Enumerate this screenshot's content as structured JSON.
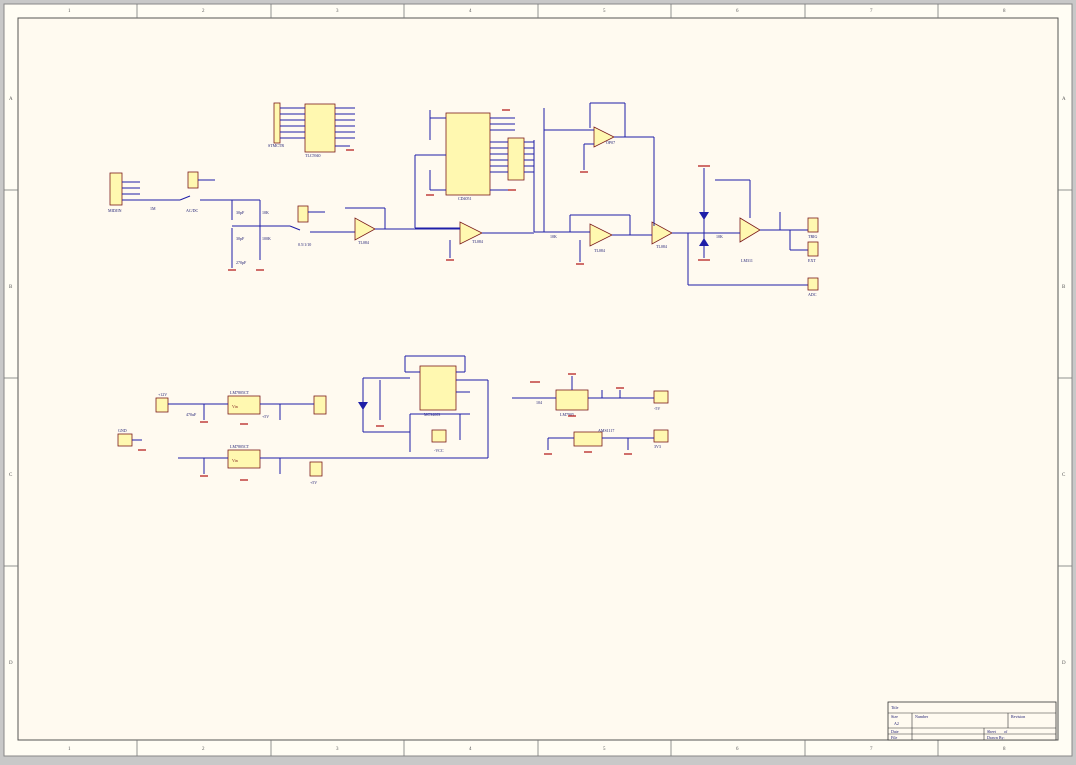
{
  "sheet": {
    "zones_top": [
      "1",
      "2",
      "3",
      "4",
      "5",
      "6",
      "7",
      "8"
    ],
    "zones_side": [
      "A",
      "B",
      "C",
      "D"
    ]
  },
  "title_block": {
    "title": "Title",
    "size_label": "Size",
    "size": "A2",
    "number_label": "Number",
    "revision_label": "Revision",
    "date_label": "Date",
    "file_label": "File",
    "sheet_label": "Sheet",
    "of_label": "of",
    "drawn_label": "Drawn By:"
  },
  "parts": {
    "tc_driver": "TLC5940",
    "cd_mux": "CD4051",
    "stepper": "STMCTR",
    "header_in": "MIDJIN",
    "relay1": "AC/DC",
    "relay2": "0.5/1/10",
    "op1": "TL084",
    "op2": "TL084",
    "op3": "TL084",
    "op4": "TL084",
    "op5": "OP07",
    "comp": "LM311",
    "reg1": "LM7805CT",
    "reg2": "LM7805CT",
    "timer": "MC34063",
    "reg3": "LM7905",
    "reg4": "AMS1117",
    "out1": "TRIG",
    "out2": "EXT",
    "out3": "ADC",
    "pwr1": "+12V",
    "pwr2": "+5V",
    "pwr3": "-5V",
    "pwr4": "3V3"
  },
  "labels": {
    "r1": "1M",
    "r2": "10K",
    "r3": "100K",
    "r4": "10K",
    "r5": "10K",
    "c1": "30pF",
    "c2": "30pF",
    "c3": "270pF",
    "c4": "470uF",
    "c5": "104",
    "gnd": "GND",
    "vin": "Vin",
    "vout": "+5V",
    "vneg": "-VCC"
  }
}
